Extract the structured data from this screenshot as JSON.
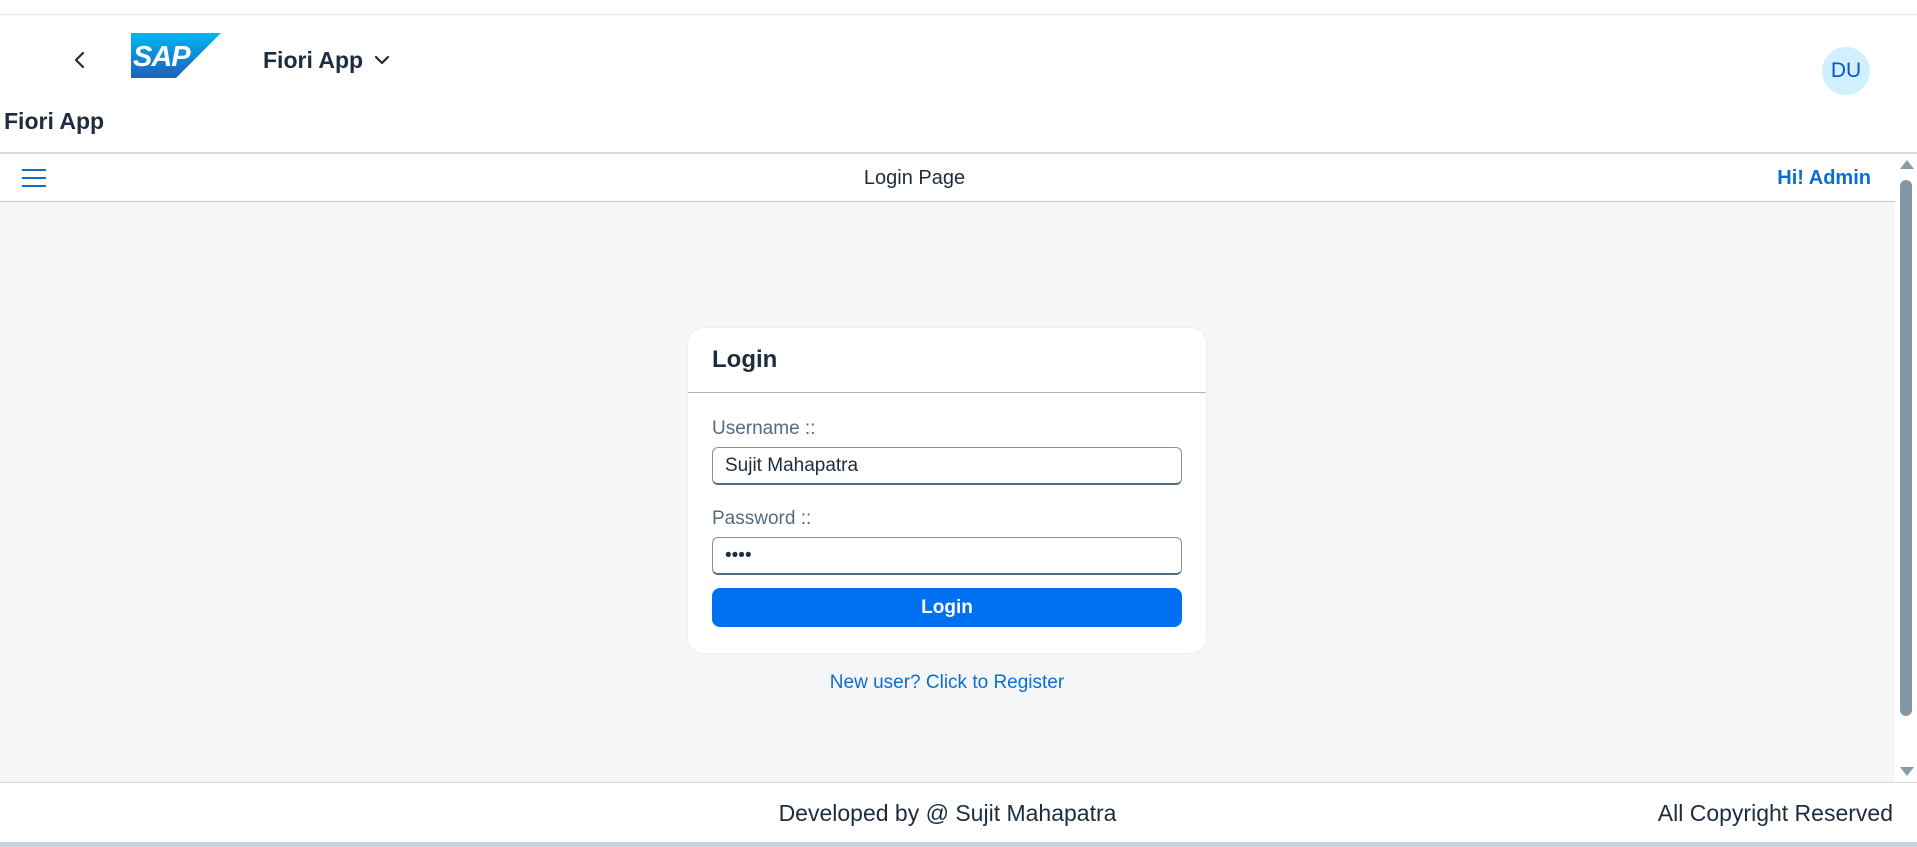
{
  "shell": {
    "logo_text": "SAP",
    "app_title": "Fiori App",
    "avatar_initials": "DU",
    "icons": {
      "back": "back-arrow-icon",
      "dropdown": "chevron-down-icon"
    }
  },
  "page": {
    "heading": "Fiori App"
  },
  "subheader": {
    "title": "Login Page",
    "greeting": "Hi! Admin",
    "menu_icon": "menu-icon"
  },
  "login_card": {
    "title": "Login",
    "username_label": "Username ::",
    "username_value": "Sujit Mahapatra",
    "password_label": "Password ::",
    "password_value": "••••",
    "login_button": "Login"
  },
  "register_link": "New user? Click to Register",
  "footer": {
    "developer": "Developed by @ Sujit Mahapatra",
    "copyright": "All Copyright Reserved"
  },
  "colors": {
    "accent": "#0070f2",
    "link": "#0a6ed1",
    "background": "#f5f6f7"
  }
}
